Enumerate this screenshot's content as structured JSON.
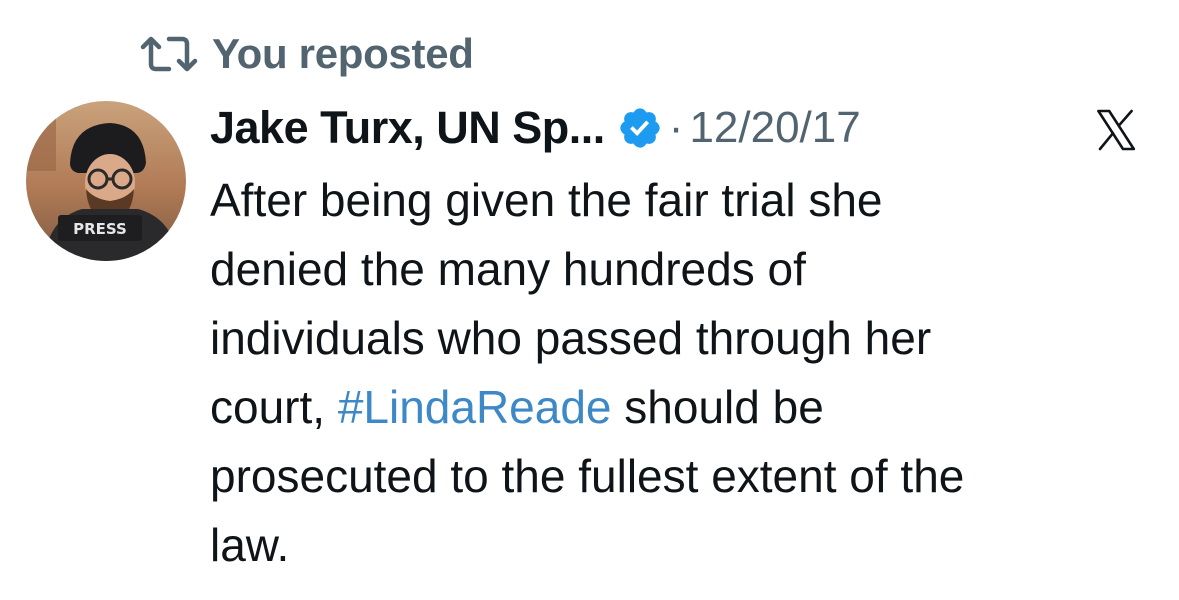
{
  "repost": {
    "label": "You reposted",
    "icon": "repost-icon"
  },
  "author": {
    "name": "Jake Turx, UN Sp...",
    "verified": true,
    "verified_icon": "verified-badge-icon",
    "avatar": {
      "icon": "avatar-photo",
      "vest_label": "PRESS"
    }
  },
  "meta": {
    "separator": "·",
    "date": "12/20/17"
  },
  "platform_logo": "x-logo-icon",
  "post": {
    "lines": [
      {
        "before": "After being given the fair trial she",
        "hashtag": "",
        "after": ""
      },
      {
        "before": "denied the many hundreds of",
        "hashtag": "",
        "after": ""
      },
      {
        "before": "individuals who passed through her",
        "hashtag": "",
        "after": ""
      },
      {
        "before": "court, ",
        "hashtag": "#LindaReade",
        "after": " should be"
      },
      {
        "before": "prosecuted to the fullest extent of the",
        "hashtag": "",
        "after": ""
      },
      {
        "before": "law.",
        "hashtag": "",
        "after": ""
      }
    ]
  },
  "colors": {
    "text": "#0f1419",
    "muted": "#536471",
    "hashtag": "#3d88c6",
    "verified": "#1d9bf0",
    "background": "#ffffff"
  }
}
